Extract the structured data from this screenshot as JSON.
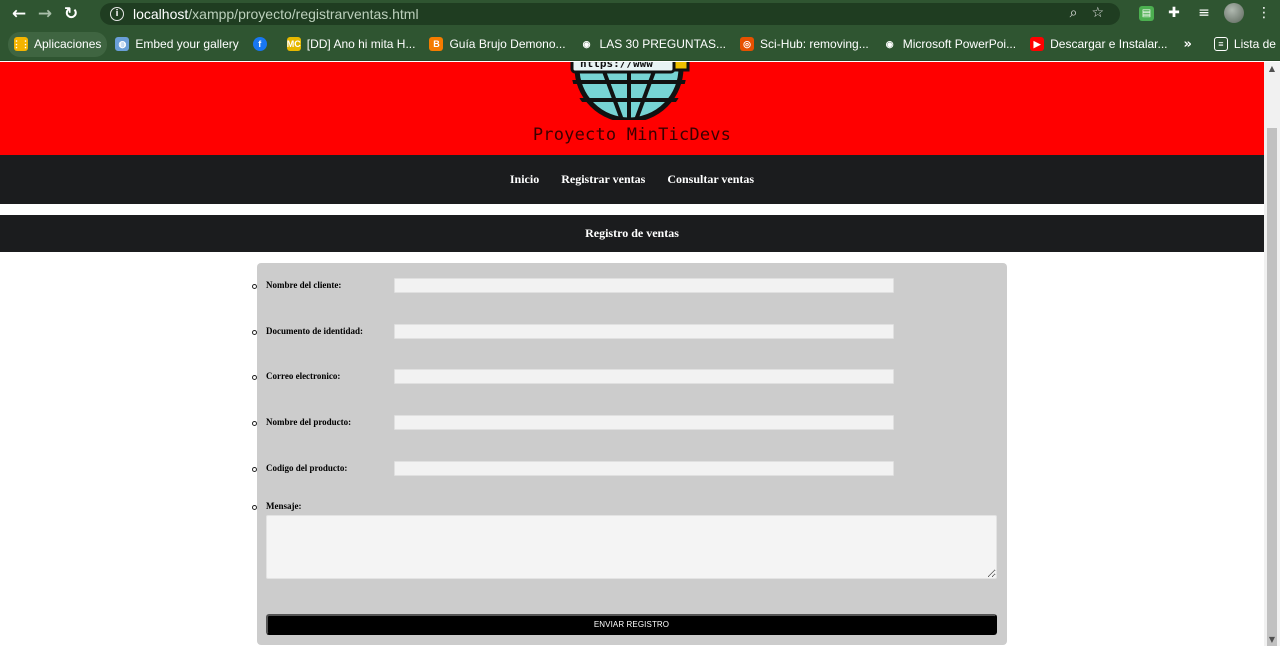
{
  "browser": {
    "url_host": "localhost",
    "url_path": "/xampp/proyecto/registrarventas.html"
  },
  "bookmarks": [
    {
      "label": "Aplicaciones",
      "icon": "apps-grid-icon",
      "color": "#f4b400"
    },
    {
      "label": "Embed your gallery",
      "icon": "gallery-icon",
      "color": "#6a9fd8"
    },
    {
      "label": "",
      "icon": "facebook-icon",
      "color": "#1877f2"
    },
    {
      "label": "[DD] Ano hi mita H...",
      "icon": "mc-icon",
      "color": "#e6b800"
    },
    {
      "label": "Guía Brujo Demono...",
      "icon": "blogger-icon",
      "color": "#f57c00"
    },
    {
      "label": "LAS 30 PREGUNTAS...",
      "icon": "globe-icon",
      "color": "#ffffff"
    },
    {
      "label": "Sci-Hub: removing...",
      "icon": "scihub-icon",
      "color": "#e65100"
    },
    {
      "label": "Microsoft PowerPoi...",
      "icon": "globe-icon",
      "color": "#ffffff"
    },
    {
      "label": "Descargar e Instalar...",
      "icon": "youtube-icon",
      "color": "#ff0000"
    }
  ],
  "bookmarks_more": "»",
  "reading_list": "Lista de lectura",
  "site": {
    "logo_text": "https://www",
    "title": "Proyecto MinTicDevs",
    "nav": [
      "Inicio",
      "Registrar ventas",
      "Consultar ventas"
    ],
    "section_title": "Registro de ventas"
  },
  "form": {
    "fields": [
      {
        "label": "Nombre del cliente:",
        "value": ""
      },
      {
        "label": "Documento de identidad:",
        "value": ""
      },
      {
        "label": "Correo electronico:",
        "value": ""
      },
      {
        "label": "Nombre del producto:",
        "value": ""
      },
      {
        "label": "Codigo del producto:",
        "value": ""
      }
    ],
    "message_label": "Mensaje:",
    "message_value": "",
    "submit_label": "ENVIAR REGISTRO"
  },
  "colors": {
    "hero": "#ff0000",
    "navbar": "#1b1c1e",
    "form_bg": "#cccccc",
    "browser_frame": "#2f5531"
  }
}
